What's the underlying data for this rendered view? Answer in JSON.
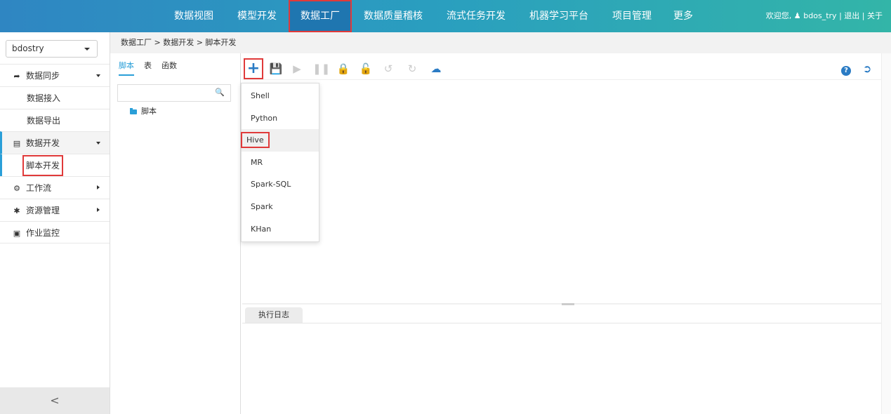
{
  "nav": {
    "items": [
      {
        "label": "数据视图"
      },
      {
        "label": "模型开发"
      },
      {
        "label": "数据工厂",
        "active": true
      },
      {
        "label": "数据质量稽核"
      },
      {
        "label": "流式任务开发"
      },
      {
        "label": "机器学习平台"
      },
      {
        "label": "项目管理"
      },
      {
        "label": "更多"
      }
    ],
    "welcome": "欢迎您,",
    "username": "bdos_try",
    "logout": "退出",
    "about": "关于",
    "separator": "|"
  },
  "sidebar": {
    "project": "bdostry",
    "items": [
      {
        "label": "数据同步",
        "icon": "share-arrow-icon",
        "type": "group",
        "expanded": true
      },
      {
        "label": "数据接入",
        "type": "sub"
      },
      {
        "label": "数据导出",
        "type": "sub"
      },
      {
        "label": "数据开发",
        "icon": "document-icon",
        "type": "group",
        "expanded": true
      },
      {
        "label": "脚本开发",
        "type": "sub",
        "active": true
      },
      {
        "label": "工作流",
        "icon": "cogs-icon",
        "type": "group",
        "expanded": false
      },
      {
        "label": "资源管理",
        "icon": "gear-icon",
        "type": "group",
        "expanded": false
      },
      {
        "label": "作业监控",
        "icon": "monitor-icon",
        "type": "group"
      }
    ],
    "collapse": "<"
  },
  "breadcrumb": "数据工厂 > 数据开发 > 脚本开发",
  "tree": {
    "tabs": [
      "脚本",
      "表",
      "函数"
    ],
    "root": "脚本"
  },
  "toolbar": {
    "icons": [
      "plus-icon",
      "save-icon",
      "play-icon",
      "pause-icon",
      "lock-icon",
      "unlock-icon",
      "undo-icon",
      "redo-icon",
      "cloud-upload-icon",
      "help-icon",
      "exit-icon"
    ]
  },
  "dropdown": {
    "items": [
      "Shell",
      "Python",
      "Hive",
      "MR",
      "Spark-SQL",
      "Spark",
      "KHan"
    ],
    "hovered": "Hive"
  },
  "log": {
    "tab": "执行日志"
  },
  "colors": {
    "accent": "#2a9fd8",
    "header_start": "#2f86c2",
    "header_end": "#33b5a8",
    "highlight": "#e03a3a"
  }
}
